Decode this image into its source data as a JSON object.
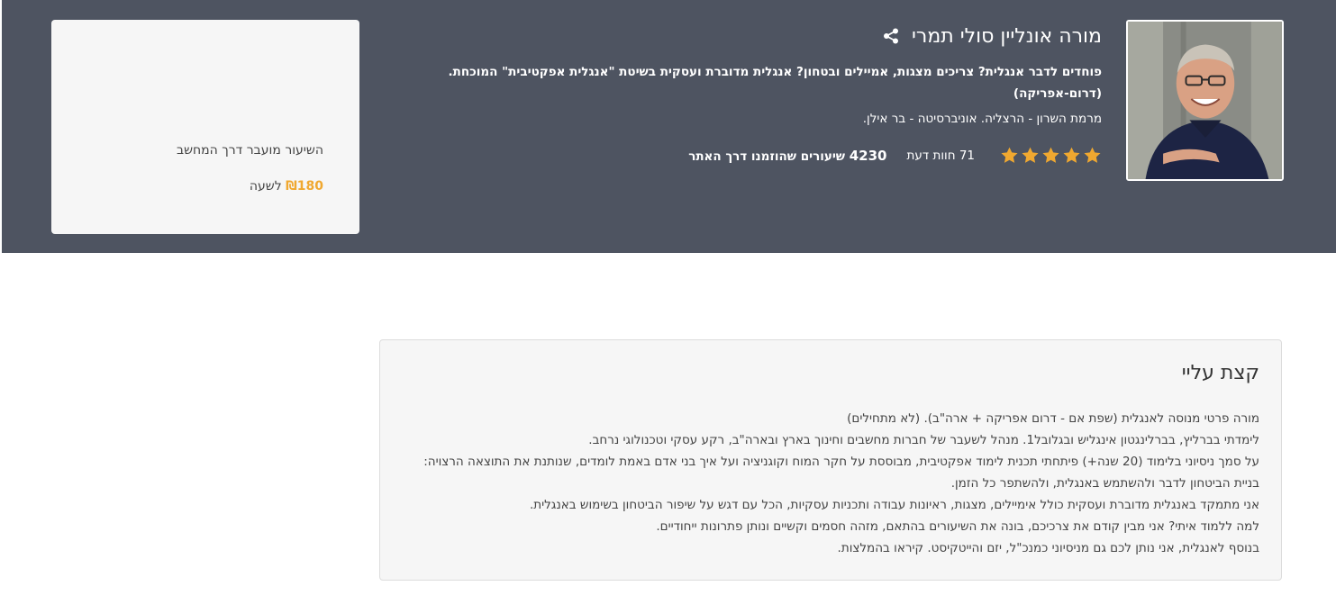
{
  "teacher": {
    "name": "מורה אונליין סולי תמרי",
    "tagline": "פוחדים לדבר אנגלית? צריכים מצגות, אמיילים ובטחון? אנגלית מדוברת ועסקית בשיטת \"אנגלית אפקטיבית\" המוכחת. (דרום-אפריקה)",
    "location": "מרמת השרון - הרצליה. אוניברסיטה - בר אילן.",
    "rating_stars": 5,
    "reviews_label": "71 חוות דעת",
    "lessons_count": "4230",
    "lessons_label": "שיעורים שהוזמנו דרך האתר"
  },
  "price_card": {
    "mode_label": "השיעור מועבר דרך המחשב",
    "price_amount": "₪180",
    "price_unit": "לשעה"
  },
  "about": {
    "title": "קצת עליי",
    "lines": [
      "מורה פרטי מנוסה לאנגלית (שפת אם - דרום אפריקה + ארה\"ב). (לא מתחילים)",
      "לימדתי בברליץ, בברלינגטון אינגליש ובגלובל1. מנהל לשעבר של חברות מחשבים וחינוך בארץ ובארה\"ב, רקע עסקי וטכנולוגי נרחב.",
      "על סמך ניסיוני בלימוד (20 שנה+) פיתחתי תכנית לימוד אפקטיבית, מבוססת על חקר המוח וקוגניציה ועל איך בני אדם באמת לומדים, שנותנת את התוצאה הרצויה: בניית הביטחון לדבר ולהשתמש באנגלית, ולהשתפר כל הזמן.",
      "אני מתמקד באנגלית מדוברת ועסקית כולל אימיילים, מצגות, ראיונות עבודה ותכניות עסקיות, הכל עם דגש על שיפור הביטחון בשימוש באנגלית.",
      "למה ללמוד איתי? אני מבין קודם את צרכיכם, בונה את השיעורים בהתאם, מזהה חסמים וקשיים ונותן פתרונות ייחודיים.",
      "בנוסף לאנגלית, אני נותן לכם גם מניסיוני כמנכ\"ל, יזם והייטקיסט. קיראו בהמלצות."
    ]
  },
  "colors": {
    "hero_bg": "#4e5461",
    "star": "#f0a830",
    "price": "#f0a830"
  },
  "icons": {
    "share": "share-icon",
    "star": "star-icon"
  }
}
